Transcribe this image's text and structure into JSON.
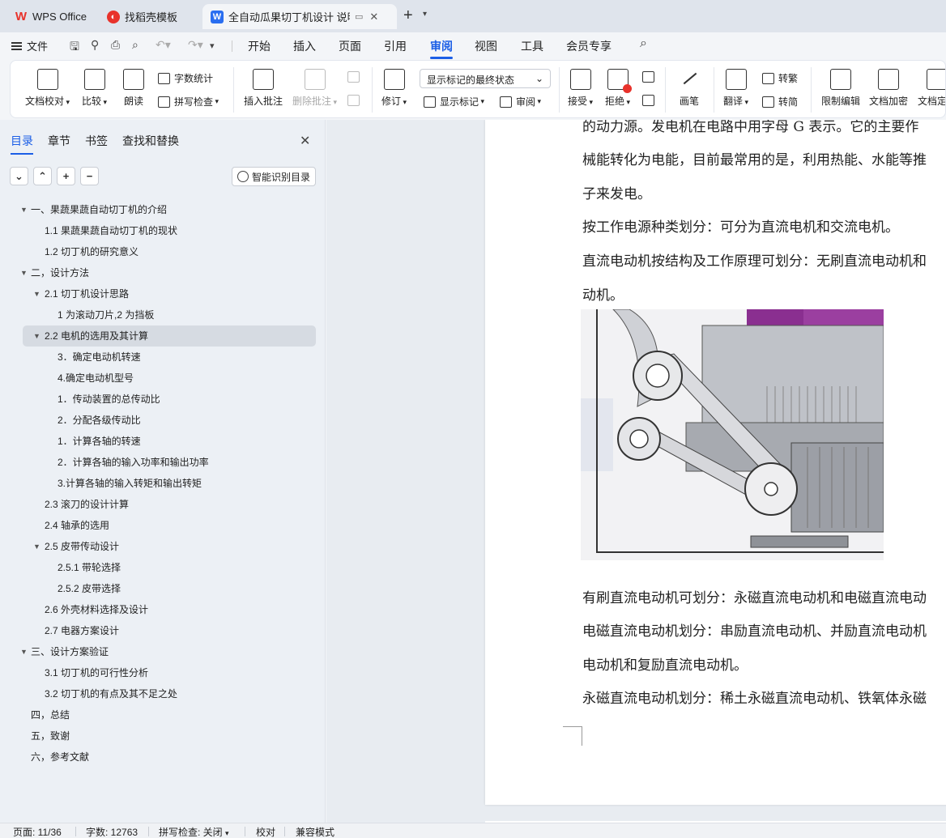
{
  "tabs": [
    {
      "label": "WPS Office",
      "icon": "wps-logo-icon",
      "color": "#e8322b"
    },
    {
      "label": "找稻壳模板",
      "icon": "docer-icon",
      "color": "#e8322b"
    },
    {
      "label": "全自动瓜果切丁机设计 说明书",
      "icon": "writer-doc-icon",
      "color": "#2a6ef0"
    }
  ],
  "menu": {
    "file": "文件",
    "tabs": [
      "开始",
      "插入",
      "页面",
      "引用",
      "审阅",
      "视图",
      "工具",
      "会员专享"
    ],
    "active": "审阅"
  },
  "ribbon": {
    "doc_proof": "文档校对",
    "compare": "比较",
    "read_aloud": "朗读",
    "word_count": "字数统计",
    "spell_check": "拼写检查",
    "insert_comment": "插入批注",
    "delete_comment": "删除批注",
    "track_changes": "修订",
    "display_mode": "显示标记的最终状态",
    "show_markup": "显示标记",
    "review": "审阅",
    "accept": "接受",
    "reject": "拒绝",
    "ink": "画笔",
    "translate": "翻译",
    "to_traditional": "转繁",
    "to_simplified": "转简",
    "restrict_edit": "限制编辑",
    "encrypt": "文档加密",
    "finalize": "文档定稿"
  },
  "nav": {
    "tabs": [
      "目录",
      "章节",
      "书签",
      "查找和替换"
    ],
    "active": "目录",
    "smart_toc": "智能识别目录",
    "toc": [
      {
        "text": "一、果蔬果蔬自动切丁机的介绍",
        "level": 1,
        "expanded": true
      },
      {
        "text": "1.1 果蔬果蔬自动切丁机的现状",
        "level": 2
      },
      {
        "text": "1.2 切丁机的研究意义",
        "level": 2
      },
      {
        "text": "二，设计方法",
        "level": 1,
        "expanded": true
      },
      {
        "text": "2.1 切丁机设计思路",
        "level": 2,
        "expanded": true
      },
      {
        "text": "1 为滚动刀片,2 为挡板",
        "level": 3
      },
      {
        "text": "2.2 电机的选用及其计算",
        "level": 2,
        "expanded": true,
        "selected": true
      },
      {
        "text": "3．确定电动机转速",
        "level": 3
      },
      {
        "text": "4.确定电动机型号",
        "level": 3
      },
      {
        "text": "1．传动装置的总传动比",
        "level": 3
      },
      {
        "text": "2．分配各级传动比",
        "level": 3
      },
      {
        "text": "1．计算各轴的转速",
        "level": 3
      },
      {
        "text": "2．计算各轴的输入功率和输出功率",
        "level": 3
      },
      {
        "text": "3.计算各轴的输入转矩和输出转矩",
        "level": 3
      },
      {
        "text": "2.3 滚刀的设计计算",
        "level": 2
      },
      {
        "text": "2.4 轴承的选用",
        "level": 2
      },
      {
        "text": "2.5 皮带传动设计",
        "level": 2,
        "expanded": true
      },
      {
        "text": "2.5.1 带轮选择",
        "level": 3
      },
      {
        "text": "2.5.2 皮带选择",
        "level": 3
      },
      {
        "text": "2.6 外壳材料选择及设计",
        "level": 2
      },
      {
        "text": "2.7 电器方案设计",
        "level": 2
      },
      {
        "text": "三、设计方案验证",
        "level": 1,
        "expanded": true
      },
      {
        "text": "3.1 切丁机的可行性分析",
        "level": 2
      },
      {
        "text": "3.2 切丁机的有点及其不足之处",
        "level": 2
      },
      {
        "text": "四，总结",
        "level": 1
      },
      {
        "text": "五，致谢",
        "level": 1
      },
      {
        "text": "六，参考文献",
        "level": 1
      }
    ]
  },
  "document": {
    "lines_top": [
      "的动力源。发电机在电路中用字母 G 表示。它的主要作",
      "械能转化为电能，目前最常用的是，利用热能、水能等推",
      "子来发电。",
      "按工作电源种类划分：可分为直流电机和交流电机。",
      "直流电动机按结构及工作原理可划分：无刷直流电动机和",
      "动机。"
    ],
    "lines_bottom": [
      "有刷直流电动机可划分：永磁直流电动机和电磁直流电动",
      "电磁直流电动机划分：串励直流电动机、并励直流电动机",
      "电动机和复励直流电动机。",
      "永磁直流电动机划分：稀土永磁直流电动机、铁氧体永磁"
    ]
  },
  "status": {
    "page": "页面: 11/36",
    "words": "字数: 12763",
    "spell": "拼写检查: 关闭",
    "proof": "校对",
    "compat": "兼容模式"
  },
  "colors": {
    "accent": "#1b5ee6",
    "wps_red": "#e8322b",
    "figure_purple": "#9b3fa0"
  }
}
